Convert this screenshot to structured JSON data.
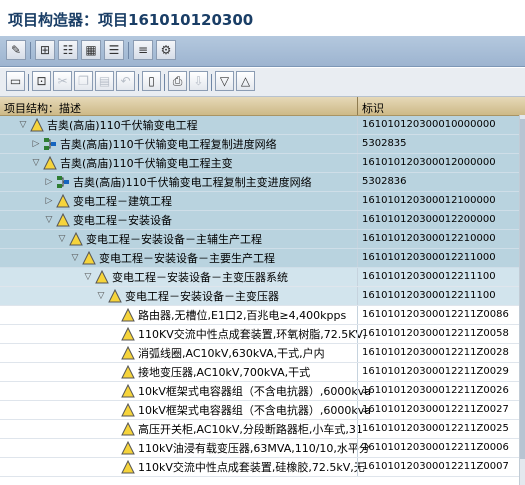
{
  "window_title": "项目构造器：项目161010120300",
  "app_toolbar": {
    "buttons": [
      "edit-icon",
      "structure-icon",
      "project-icon",
      "grid-icon",
      "list-icon",
      "document-icon",
      "settings-icon"
    ]
  },
  "toolbar": {
    "buttons": [
      "open-icon",
      "create-icon",
      "cut-icon",
      "copy-icon",
      "paste-icon",
      "delete-icon",
      "print-icon",
      "export-icon",
      "filter-icon",
      "sort-icon"
    ]
  },
  "tree": {
    "col1_header": "项目结构：描述",
    "col2_header": "标识",
    "rows": [
      {
        "text": "吉奥(高庙)110千伏输变电工程",
        "id": "161010120300010000000",
        "icon": "triangle",
        "expander": "▽",
        "level": 0,
        "style": "blue"
      },
      {
        "text": "吉奥(高庙)110千伏输变电工程复制进度网络",
        "id": "5302835",
        "icon": "network",
        "expander": "▷",
        "level": 1,
        "style": "blue"
      },
      {
        "text": "吉奥(高庙)110千伏输变电工程主变",
        "id": "161010120300012000000",
        "icon": "triangle",
        "expander": "▽",
        "level": 1,
        "style": "blue"
      },
      {
        "text": "吉奥(高庙)110千伏输变电工程复制主变进度网络",
        "id": "5302836",
        "icon": "network",
        "expander": "▷",
        "level": 2,
        "style": "blue"
      },
      {
        "text": "变电工程－建筑工程",
        "id": "161010120300012100000",
        "icon": "triangle",
        "expander": "▷",
        "level": 2,
        "style": "blue"
      },
      {
        "text": "变电工程－安装设备",
        "id": "161010120300012200000",
        "icon": "triangle",
        "expander": "▽",
        "level": 2,
        "style": "blue"
      },
      {
        "text": "变电工程－安装设备－主辅生产工程",
        "id": "161010120300012210000",
        "icon": "triangle",
        "expander": "▽",
        "level": 3,
        "style": "blue"
      },
      {
        "text": "变电工程－安装设备－主要生产工程",
        "id": "161010120300012211000",
        "icon": "triangle",
        "expander": "▽",
        "level": 4,
        "style": "blue"
      },
      {
        "text": "变电工程－安装设备－主变压器系统",
        "id": "161010120300012211100",
        "icon": "triangle",
        "expander": "▽",
        "level": 5,
        "style": "pale"
      },
      {
        "text": "变电工程－安装设备－主变压器",
        "id": "161010120300012211100",
        "icon": "triangle",
        "expander": "▽",
        "level": 6,
        "style": "pale"
      },
      {
        "text": "路由器,无槽位,E1口2,百兆电≥4,400kpps",
        "id": "161010120300012211Z0086",
        "icon": "triangle",
        "expander": "",
        "level": 7,
        "style": "white"
      },
      {
        "text": "110KV交流中性点成套装置,环氧树脂,72.5KV,",
        "id": "161010120300012211Z0058",
        "icon": "triangle",
        "expander": "",
        "level": 7,
        "style": "white"
      },
      {
        "text": "消弧线圈,AC10kV,630kVA,干式,户内",
        "id": "161010120300012211Z0028",
        "icon": "triangle",
        "expander": "",
        "level": 7,
        "style": "white"
      },
      {
        "text": "接地变压器,AC10kV,700kVA,干式",
        "id": "161010120300012211Z0029",
        "icon": "triangle",
        "expander": "",
        "level": 7,
        "style": "white"
      },
      {
        "text": "10kV框架式电容器组（不含电抗器）,6000kva",
        "id": "161010120300012211Z0026",
        "icon": "triangle",
        "expander": "",
        "level": 7,
        "style": "white"
      },
      {
        "text": "10kV框架式电容器组（不含电抗器）,6000kva",
        "id": "161010120300012211Z0027",
        "icon": "triangle",
        "expander": "",
        "level": 7,
        "style": "white"
      },
      {
        "text": "高压开关柜,AC10kV,分段断路器柜,小车式,31",
        "id": "161010120300012211Z0025",
        "icon": "triangle",
        "expander": "",
        "level": 7,
        "style": "white"
      },
      {
        "text": "110kV油浸有载变压器,63MVA,110/10,水平分",
        "id": "161010120300012211Z0006",
        "icon": "triangle",
        "expander": "",
        "level": 7,
        "style": "white"
      },
      {
        "text": "110kV交流中性点成套装置,硅橡胶,72.5kV,无",
        "id": "161010120300012211Z0007",
        "icon": "triangle",
        "expander": "",
        "level": 7,
        "style": "white"
      }
    ]
  }
}
